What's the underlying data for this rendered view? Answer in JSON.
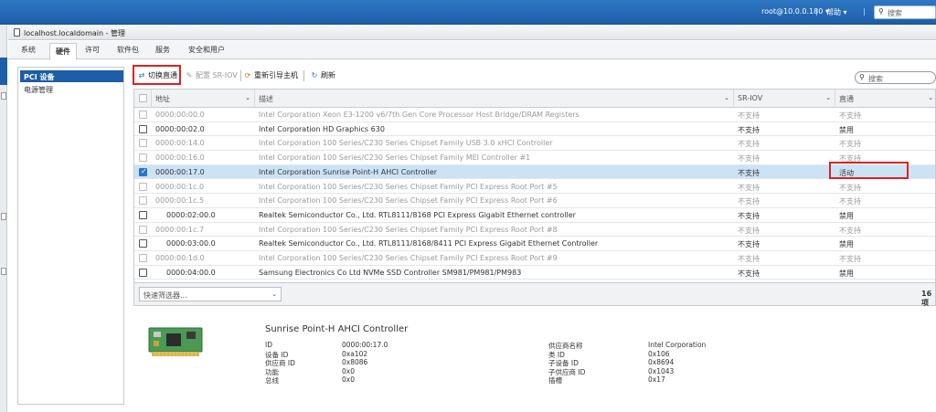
{
  "topbar": {
    "user": "root@10.0.0.180 ▾",
    "separator": "|",
    "help": "帮助 ▾",
    "search_placeholder": "搜索"
  },
  "window": {
    "title": "localhost.localdomain - 管理"
  },
  "tabs": [
    "系统",
    "硬件",
    "许可",
    "软件包",
    "服务",
    "安全和用户"
  ],
  "active_tab": "硬件",
  "sidebar": {
    "items": [
      {
        "label": "PCI 设备",
        "selected": true
      },
      {
        "label": "电源管理",
        "selected": false
      }
    ]
  },
  "toolbar": {
    "toggle_passthrough": "切换直通",
    "configure_sriov": "配置 SR-IOV",
    "reboot_host": "重新引导主机",
    "refresh": "刷新",
    "search_placeholder": "搜索"
  },
  "grid": {
    "columns": {
      "address": "地址",
      "description": "描述",
      "sriov": "SR-IOV",
      "passthrough": "直通"
    },
    "rows": [
      {
        "address": "0000:00:00.0",
        "description": "Intel Corporation Xeon E3-1200 v6/7th Gen Core Processor Host Bridge/DRAM Registers",
        "sriov": "不支持",
        "passthrough": "不支持",
        "gray": true,
        "checked": false,
        "indent": false
      },
      {
        "address": "0000:00:02.0",
        "description": "Intel Corporation HD Graphics 630",
        "sriov": "不支持",
        "passthrough": "禁用",
        "gray": false,
        "checked": false,
        "indent": false
      },
      {
        "address": "0000:00:14.0",
        "description": "Intel Corporation 100 Series/C230 Series Chipset Family USB 3.0 xHCI Controller",
        "sriov": "不支持",
        "passthrough": "不支持",
        "gray": true,
        "checked": false,
        "indent": false
      },
      {
        "address": "0000:00:16.0",
        "description": "Intel Corporation 100 Series/C230 Series Chipset Family MEI Controller #1",
        "sriov": "不支持",
        "passthrough": "不支持",
        "gray": true,
        "checked": false,
        "indent": false
      },
      {
        "address": "0000:00:17.0",
        "description": "Intel Corporation Sunrise Point-H AHCI Controller",
        "sriov": "不支持",
        "passthrough": "活动",
        "gray": false,
        "checked": true,
        "indent": false,
        "selected": true
      },
      {
        "address": "0000:00:1c.0",
        "description": "Intel Corporation 100 Series/C230 Series Chipset Family PCI Express Root Port #5",
        "sriov": "不支持",
        "passthrough": "不支持",
        "gray": true,
        "checked": false,
        "indent": false
      },
      {
        "address": "0000:00:1c.5",
        "description": "Intel Corporation 100 Series/C230 Series Chipset Family PCI Express Root Port #6",
        "sriov": "不支持",
        "passthrough": "不支持",
        "gray": true,
        "checked": false,
        "indent": false
      },
      {
        "address": "0000:02:00.0",
        "description": "Realtek Semiconductor Co., Ltd. RTL8111/8168 PCI Express Gigabit Ethernet controller",
        "sriov": "不支持",
        "passthrough": "禁用",
        "gray": false,
        "checked": false,
        "indent": true
      },
      {
        "address": "0000:00:1c.7",
        "description": "Intel Corporation 100 Series/C230 Series Chipset Family PCI Express Root Port #8",
        "sriov": "不支持",
        "passthrough": "不支持",
        "gray": true,
        "checked": false,
        "indent": false
      },
      {
        "address": "0000:03:00.0",
        "description": "Realtek Semiconductor Co., Ltd. RTL8111/8168/8411 PCI Express Gigabit Ethernet Controller",
        "sriov": "不支持",
        "passthrough": "禁用",
        "gray": false,
        "checked": false,
        "indent": true
      },
      {
        "address": "0000:00:1d.0",
        "description": "Intel Corporation 100 Series/C230 Series Chipset Family PCI Express Root Port #9",
        "sriov": "不支持",
        "passthrough": "不支持",
        "gray": true,
        "checked": false,
        "indent": false
      },
      {
        "address": "0000:04:00.0",
        "description": "Samsung Electronics Co Ltd NVMe SSD Controller SM981/PM981/PM983",
        "sriov": "不支持",
        "passthrough": "禁用",
        "gray": false,
        "checked": false,
        "indent": true
      }
    ]
  },
  "footer": {
    "quick_filter": "快速筛选器...",
    "count": "16 项"
  },
  "detail": {
    "title": "Sunrise Point-H AHCI Controller",
    "left": [
      {
        "key": "ID",
        "value": "0000:00:17.0"
      },
      {
        "key": "设备 ID",
        "value": "0xa102"
      },
      {
        "key": "供应商 ID",
        "value": "0x8086"
      },
      {
        "key": "功能",
        "value": "0x0"
      },
      {
        "key": "总线",
        "value": "0x0"
      }
    ],
    "right": [
      {
        "key": "供应商名称",
        "value": "Intel Corporation"
      },
      {
        "key": "类 ID",
        "value": "0x106"
      },
      {
        "key": "子设备 ID",
        "value": "0x8694"
      },
      {
        "key": "子供应商 ID",
        "value": "0x1043"
      },
      {
        "key": "插槽",
        "value": "0x17"
      }
    ]
  },
  "colors": {
    "topbar": "#1d5ea8",
    "selected_row": "#cce3f6",
    "highlight_box": "#e02020"
  }
}
